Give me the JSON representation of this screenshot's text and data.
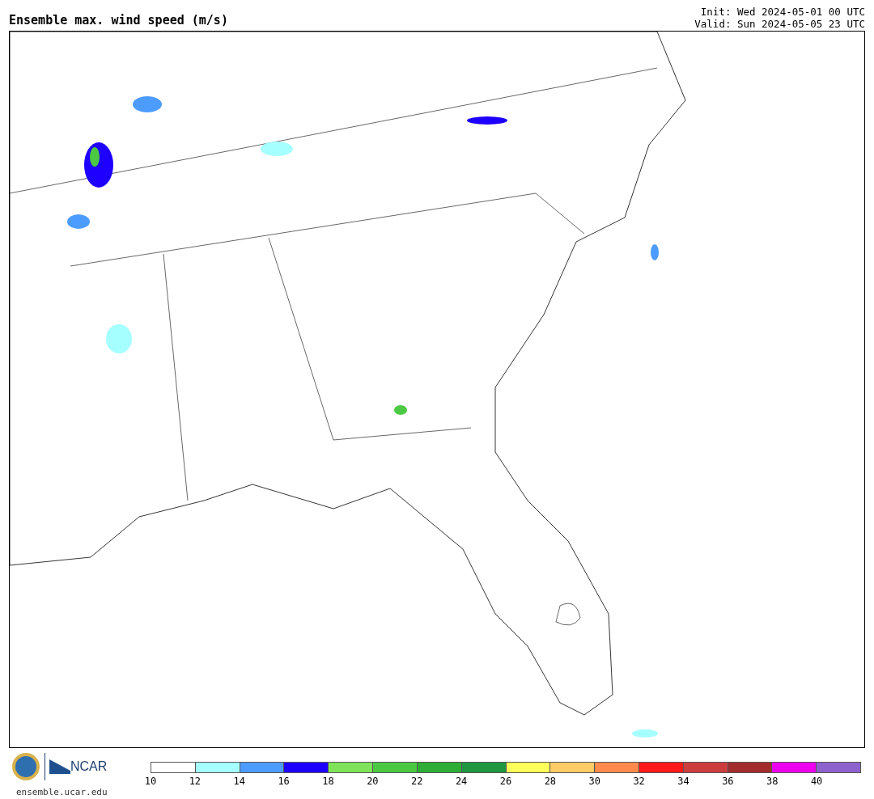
{
  "title": "Ensemble max. wind speed (m/s)",
  "init": "Init: Wed 2024-05-01 00 UTC",
  "valid": "Valid: Sun 2024-05-05 23 UTC",
  "logos": {
    "ncar": "NCAR",
    "url": "ensemble.ucar.edu"
  },
  "colorbar": {
    "bins": [
      {
        "color": "#ffffff"
      },
      {
        "color": "#a6ffff"
      },
      {
        "color": "#4c9cff"
      },
      {
        "color": "#1e00ff"
      },
      {
        "color": "#7ee25b"
      },
      {
        "color": "#4cc942"
      },
      {
        "color": "#2ead37"
      },
      {
        "color": "#1f9640"
      },
      {
        "color": "#ffff59"
      },
      {
        "color": "#ffcc66"
      },
      {
        "color": "#ff8a4c"
      },
      {
        "color": "#ff1a1a"
      },
      {
        "color": "#cc3e3e"
      },
      {
        "color": "#a32c2c"
      },
      {
        "color": "#ee00ee"
      },
      {
        "color": "#8d62cc"
      }
    ],
    "labels": [
      "10",
      "12",
      "14",
      "16",
      "18",
      "20",
      "22",
      "24",
      "26",
      "28",
      "30",
      "32",
      "34",
      "36",
      "38",
      "40"
    ]
  }
}
